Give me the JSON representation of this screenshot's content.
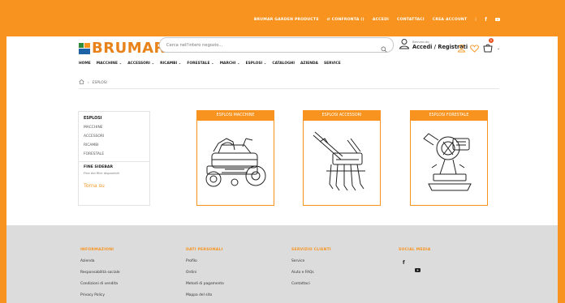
{
  "topbar": {
    "links": [
      "BRUMAR GARDEN PRODUCTS",
      "CONFRONTA ()",
      "ACCEDI",
      "CONTATTACI",
      "CREA ACCOUNT"
    ]
  },
  "brand": {
    "logo": "BRUMAR",
    "colors": {
      "accent": "#f7931e",
      "logo_green": "#2e8b3a",
      "logo_blue": "#1e63a8",
      "footer_bg": "#dcdcdc"
    }
  },
  "search": {
    "placeholder": "Cerca nell'intero negozio..."
  },
  "account": {
    "welcome": "Benvenuto",
    "login_label": "Accedi / Registrati",
    "cart_count": "0"
  },
  "nav": {
    "items": [
      "HOME",
      "MACCHINE",
      "ACCESSORI",
      "RICAMBI",
      "FORESTALE",
      "MARCHI",
      "ESPLOSI",
      "CATALOGHI",
      "AZIENDA",
      "SERVICE"
    ]
  },
  "breadcrumb": {
    "current": "ESPLOSI"
  },
  "sidebar": {
    "title": "ESPLOSI",
    "items": [
      "MACCHINE",
      "ACCESSORI",
      "RICAMBI",
      "FORESTALE"
    ],
    "fine_title": "FINE SIDEBAR",
    "fine_note": "Fine dei filtri disponibili",
    "back_to_top": "Torna su"
  },
  "cards": [
    {
      "title": "ESPLOSI MACCHINE",
      "image_icon": "lawn-tractor-drawing"
    },
    {
      "title": "ESPLOSI ACCESSORI",
      "image_icon": "cultivator-drawing"
    },
    {
      "title": "ESPLOSI FORESTALE",
      "image_icon": "chain-grinder-drawing"
    }
  ],
  "footer": {
    "columns": [
      {
        "heading": "INFORMAZIONI",
        "links": [
          "Azienda",
          "Responsabilità sociale",
          "Condizioni di vendita",
          "Privacy Policy"
        ]
      },
      {
        "heading": "DATI PERSONALI",
        "links": [
          "Profilo",
          "Ordini",
          "Metodi di pagamento",
          "Mappa del sito"
        ]
      },
      {
        "heading": "SERVIZIO CLIENTI",
        "links": [
          "Service",
          "Aiuto e FAQs",
          "Contattaci"
        ]
      },
      {
        "heading": "SOCIAL MEDIA",
        "links": []
      }
    ]
  }
}
